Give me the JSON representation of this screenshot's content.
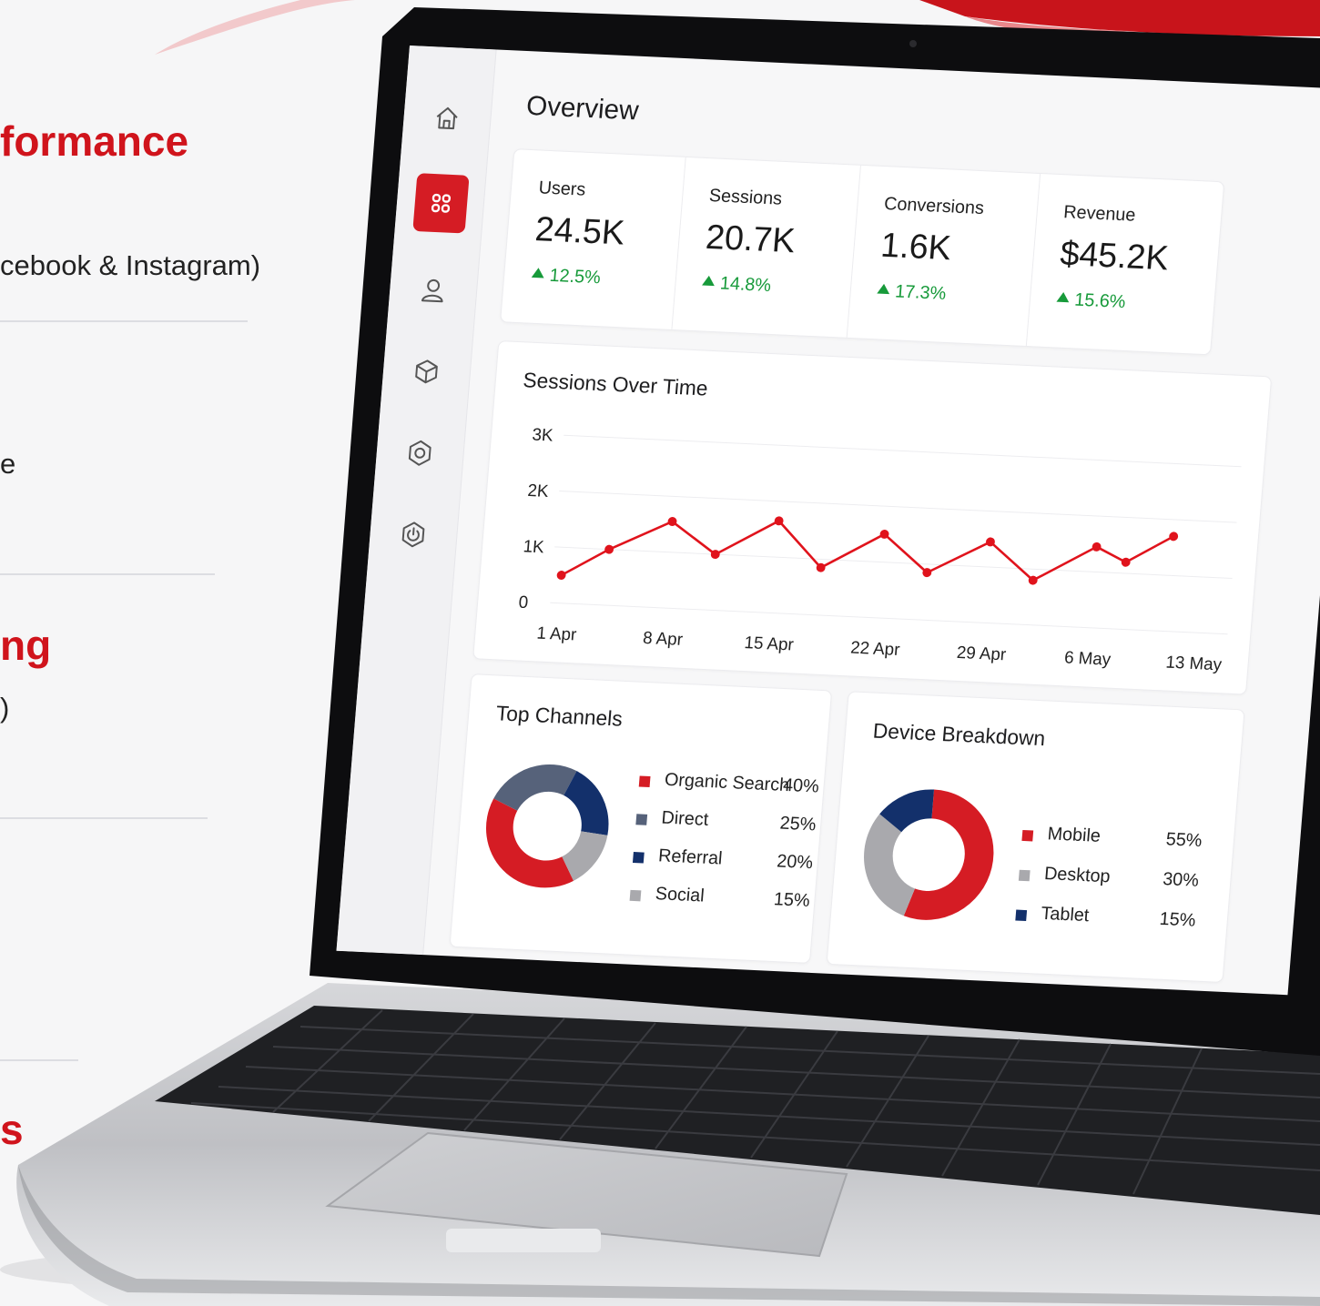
{
  "left_panel": {
    "heading_1": "formance",
    "line_1": "cebook & Instagram)",
    "line_2": "e",
    "heading_2": "ng",
    "line_3": ")",
    "heading_3": "s"
  },
  "colors": {
    "accent_red": "#d51c24",
    "navy": "#13306b",
    "gray": "#a9a9ad",
    "slate": "#56627a",
    "positive_green": "#179a3a"
  },
  "sidebar": {
    "items": [
      {
        "icon": "home-icon"
      },
      {
        "icon": "dashboard-grid-icon",
        "active": true
      },
      {
        "icon": "user-icon"
      },
      {
        "icon": "cube-icon"
      },
      {
        "icon": "gear-icon"
      },
      {
        "icon": "power-icon"
      }
    ]
  },
  "header": {
    "title": "Overview"
  },
  "kpis": [
    {
      "label": "Users",
      "value": "24.5K",
      "delta": "12.5%"
    },
    {
      "label": "Sessions",
      "value": "20.7K",
      "delta": "14.8%"
    },
    {
      "label": "Conversions",
      "value": "1.6K",
      "delta": "17.3%"
    },
    {
      "label": "Revenue",
      "value": "$45.2K",
      "delta": "15.6%"
    }
  ],
  "chart_data": [
    {
      "type": "line",
      "title": "Sessions Over Time",
      "x_tick_labels": [
        "1 Apr",
        "8 Apr",
        "15 Apr",
        "22 Apr",
        "29 Apr",
        "6 May",
        "13 May"
      ],
      "y_tick_labels": [
        "0",
        "1K",
        "2K",
        "3K"
      ],
      "ylim": [
        0,
        3000
      ],
      "grid": true,
      "series": [
        {
          "color": "#e0131c",
          "x": [
            "1 Apr",
            "4 Apr",
            "8 Apr",
            "11 Apr",
            "15 Apr",
            "18 Apr",
            "22 Apr",
            "25 Apr",
            "29 Apr",
            "2 May",
            "6 May",
            "8 May",
            "11 May"
          ],
          "y": [
            500,
            1000,
            1550,
            1000,
            1650,
            850,
            1500,
            850,
            1450,
            800,
            1450,
            1200,
            1700
          ]
        }
      ]
    },
    {
      "type": "pie",
      "title": "Top Channels",
      "donut": true,
      "categories": [
        "Organic Search",
        "Direct",
        "Referral",
        "Social"
      ],
      "labels": [
        "40%",
        "25%",
        "20%",
        "15%"
      ],
      "values": [
        40,
        25,
        20,
        15
      ],
      "legend_colors": [
        "#d51c24",
        "#56627a",
        "#13306b",
        "#a9a9ad"
      ]
    },
    {
      "type": "pie",
      "title": "Device Breakdown",
      "donut": true,
      "categories": [
        "Mobile",
        "Desktop",
        "Tablet"
      ],
      "labels": [
        "55%",
        "30%",
        "15%"
      ],
      "values": [
        55,
        30,
        15
      ],
      "legend_colors": [
        "#d51c24",
        "#a9a9ad",
        "#13306b"
      ]
    }
  ]
}
